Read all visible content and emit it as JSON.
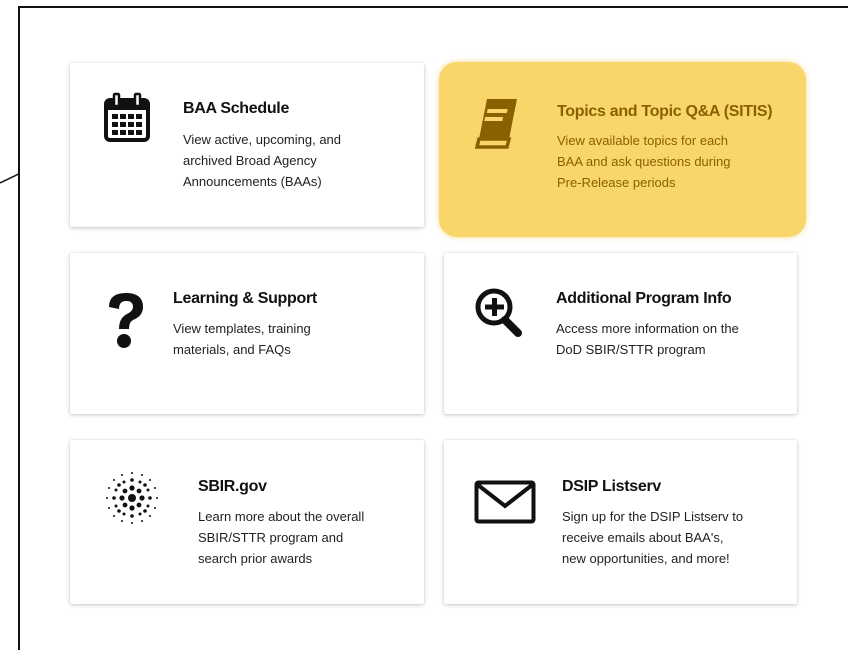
{
  "cards": [
    {
      "title": "BAA Schedule",
      "lines": [
        "View active, upcoming, and",
        "archived Broad Agency",
        "Announcements (BAAs)"
      ],
      "icon": "calendar-icon"
    },
    {
      "title": "Topics and Topic Q&A (SITIS)",
      "lines": [
        "View available topics for each",
        "BAA and ask questions during",
        "Pre-Release periods"
      ],
      "icon": "book-icon",
      "highlighted": true
    },
    {
      "title": "Learning & Support",
      "lines": [
        "View templates, training",
        "materials, and FAQs"
      ],
      "icon": "question-mark-icon"
    },
    {
      "title": "Additional Program Info",
      "lines": [
        "Access more information on the",
        "DoD SBIR/STTR program"
      ],
      "icon": "zoom-in-icon"
    },
    {
      "title": "SBIR.gov",
      "lines": [
        "Learn more about the overall",
        "SBIR/STTR program and",
        "search prior awards"
      ],
      "icon": "sbir-starburst-icon"
    },
    {
      "title": "DSIP Listserv",
      "lines": [
        "Sign up for the DSIP Listserv to",
        "receive emails about BAA's,",
        "new opportunities, and more!"
      ],
      "icon": "envelope-icon"
    }
  ],
  "colors": {
    "highlight_bg": "#f8d66a",
    "highlight_text": "#8a6100",
    "text": "#111111"
  }
}
